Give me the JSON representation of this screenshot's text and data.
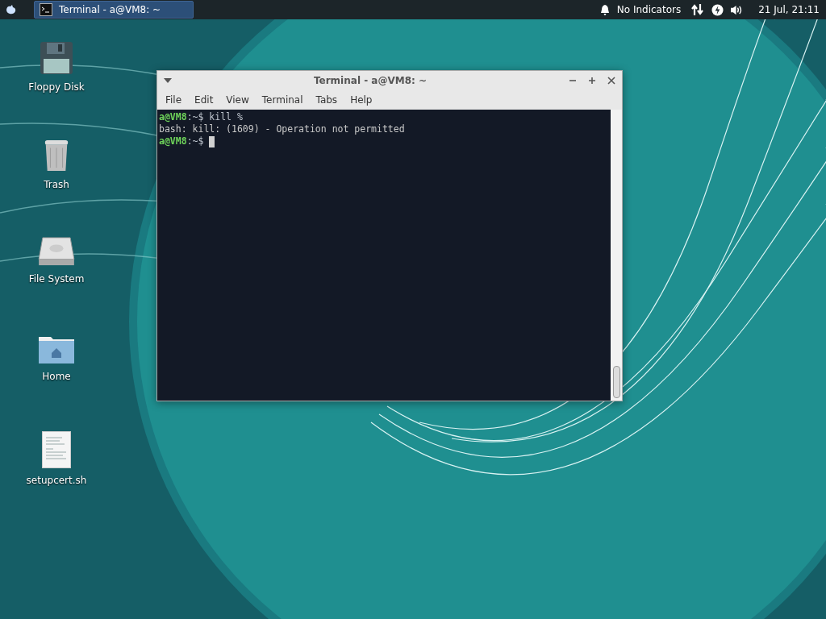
{
  "panel": {
    "tasks": [
      {
        "title": "Terminal - a@VM8: ~",
        "selected": true
      }
    ],
    "indicators_label": "No Indicators",
    "clock": "21 Jul, 21:11"
  },
  "desktop_icons": [
    {
      "label": "Floppy Disk",
      "kind": "floppy"
    },
    {
      "label": "Trash",
      "kind": "trash"
    },
    {
      "label": "File System",
      "kind": "drive"
    },
    {
      "label": "Home",
      "kind": "home"
    },
    {
      "label": "setupcert.sh",
      "kind": "script"
    }
  ],
  "window": {
    "title": "Terminal - a@VM8: ~",
    "menu": [
      "File",
      "Edit",
      "View",
      "Terminal",
      "Tabs",
      "Help"
    ],
    "lines": [
      {
        "kind": "prompt",
        "user": "a@VM8",
        "rest": ":~$ kill %",
        "cursor": false
      },
      {
        "kind": "output",
        "text": "bash: kill: (1609) - Operation not permitted"
      },
      {
        "kind": "prompt",
        "user": "a@VM8",
        "rest": ":~$ ",
        "cursor": true
      }
    ]
  }
}
